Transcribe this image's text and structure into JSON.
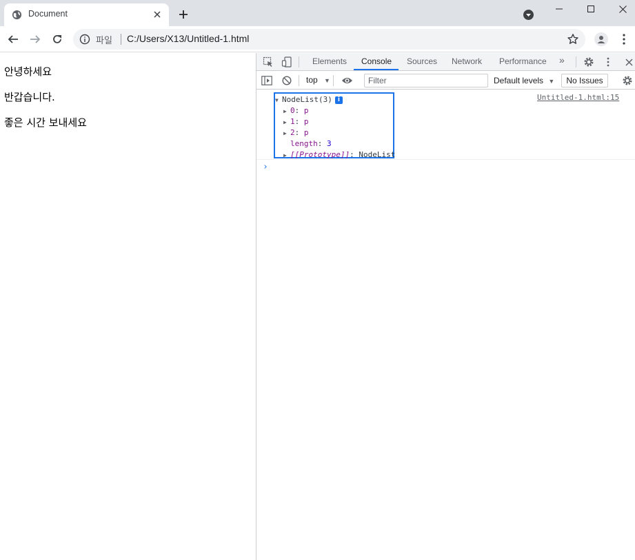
{
  "browser": {
    "tab_title": "Document",
    "tab_close_icon": "close-icon",
    "new_tab_icon": "plus-icon",
    "favicon": "globe-icon",
    "window_controls": [
      "minimize-icon",
      "maximize-icon",
      "close-icon"
    ]
  },
  "toolbar": {
    "back_icon": "arrow-left-icon",
    "forward_icon": "arrow-right-icon",
    "reload_icon": "reload-icon",
    "info_icon": "info-icon",
    "scheme_label": "파일",
    "url": "C:/Users/X13/Untitled-1.html",
    "bookmark_icon": "star-icon",
    "profile_icon": "person-icon",
    "menu_icon": "more-vert-icon"
  },
  "page": {
    "paragraphs": [
      "안녕하세요",
      "반갑습니다.",
      "좋은 시간 보내세요"
    ]
  },
  "devtools": {
    "tabs": [
      "Elements",
      "Console",
      "Sources",
      "Network",
      "Performance"
    ],
    "active_tab": "Console",
    "more_tabs": "»",
    "console_bar": {
      "context": "top",
      "filter_placeholder": "Filter",
      "levels": "Default levels",
      "issues": "No Issues"
    },
    "log": {
      "source": "Untitled-1.html:15",
      "header": "NodeList(3)",
      "info_badge": "i",
      "items": [
        {
          "key": "0",
          "value": "p"
        },
        {
          "key": "1",
          "value": "p"
        },
        {
          "key": "2",
          "value": "p"
        }
      ],
      "length_key": "length",
      "length_value": "3",
      "proto_key": "[[Prototype]]",
      "proto_value": "NodeList"
    },
    "prompt": "›"
  },
  "colors": {
    "accent": "#1a73e8",
    "tabstrip": "#dee1e6",
    "omnibox": "#f1f3f4"
  }
}
